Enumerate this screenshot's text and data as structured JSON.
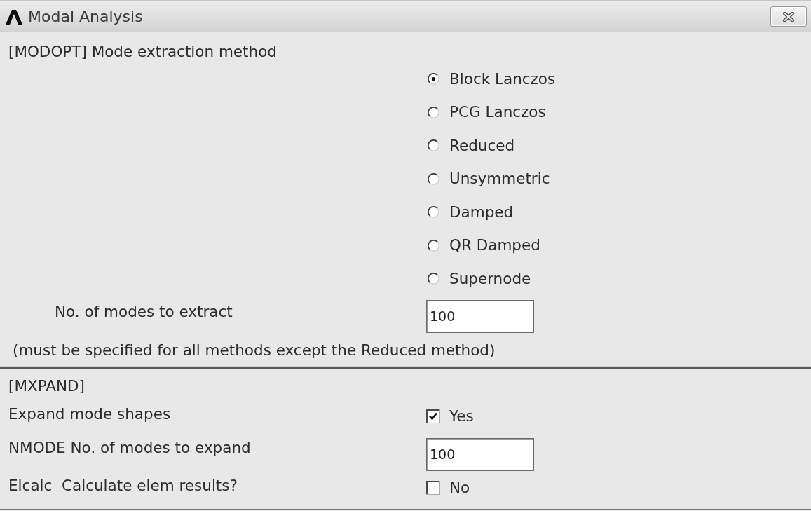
{
  "window": {
    "title": "Modal Analysis"
  },
  "modopt": {
    "heading": "[MODOPT] Mode extraction method",
    "methods": [
      {
        "label": "Block Lanczos",
        "selected": true
      },
      {
        "label": "PCG Lanczos",
        "selected": false
      },
      {
        "label": "Reduced",
        "selected": false
      },
      {
        "label": "Unsymmetric",
        "selected": false
      },
      {
        "label": "Damped",
        "selected": false
      },
      {
        "label": "QR Damped",
        "selected": false
      },
      {
        "label": "Supernode",
        "selected": false
      }
    ],
    "modes_to_extract": {
      "label": "No. of modes to extract",
      "value": "100"
    },
    "note": "(must be specified for all methods except the Reduced method)"
  },
  "mxpand": {
    "heading": "[MXPAND]",
    "fields": [
      {
        "kind": "checkbox",
        "label": "Expand mode shapes",
        "option": "Yes",
        "checked": true
      },
      {
        "kind": "input",
        "label": "NMODE No. of modes to expand",
        "value": "100"
      },
      {
        "kind": "checkbox",
        "label": "Elcalc  Calculate elem results?",
        "option": "No",
        "checked": false
      }
    ]
  }
}
